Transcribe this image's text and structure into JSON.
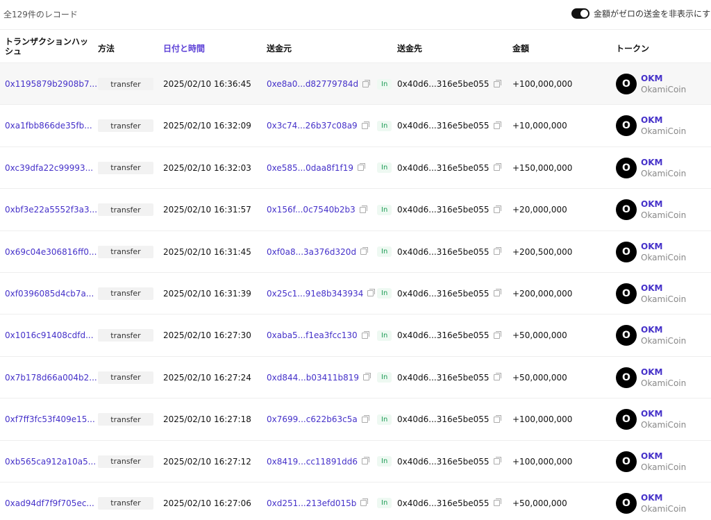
{
  "summary": {
    "record_count": "全129件のレコード",
    "hide_zero_label": "金額がゼロの送金を非表示にする"
  },
  "columns": {
    "hash": "トランザクションハッシュ",
    "method": "方法",
    "time": "日付と時間",
    "from": "送金元",
    "to": "送金先",
    "amount": "金額",
    "token": "トークン"
  },
  "rows": [
    {
      "hash": "0x1195879b2908b7...",
      "method": "transfer",
      "time": "2025/02/10 16:36:45",
      "from": "0xe8a0...d82779784d",
      "direction": "In",
      "to": "0x40d6...316e5be055",
      "amount": "+100,000,000",
      "token_symbol": "OKM",
      "token_name": "OkamiCoin",
      "token_logo": "O"
    },
    {
      "hash": "0xa1fbb866de35fb...",
      "method": "transfer",
      "time": "2025/02/10 16:32:09",
      "from": "0x3c74...26b37c08a9",
      "direction": "In",
      "to": "0x40d6...316e5be055",
      "amount": "+10,000,000",
      "token_symbol": "OKM",
      "token_name": "OkamiCoin",
      "token_logo": "O"
    },
    {
      "hash": "0xc39dfa22c99993...",
      "method": "transfer",
      "time": "2025/02/10 16:32:03",
      "from": "0xe585...0daa8f1f19",
      "direction": "In",
      "to": "0x40d6...316e5be055",
      "amount": "+150,000,000",
      "token_symbol": "OKM",
      "token_name": "OkamiCoin",
      "token_logo": "O"
    },
    {
      "hash": "0xbf3e22a5552f3a3...",
      "method": "transfer",
      "time": "2025/02/10 16:31:57",
      "from": "0x156f...0c7540b2b3",
      "direction": "In",
      "to": "0x40d6...316e5be055",
      "amount": "+20,000,000",
      "token_symbol": "OKM",
      "token_name": "OkamiCoin",
      "token_logo": "O"
    },
    {
      "hash": "0x69c04e306816ff0...",
      "method": "transfer",
      "time": "2025/02/10 16:31:45",
      "from": "0xf0a8...3a376d320d",
      "direction": "In",
      "to": "0x40d6...316e5be055",
      "amount": "+200,500,000",
      "token_symbol": "OKM",
      "token_name": "OkamiCoin",
      "token_logo": "O"
    },
    {
      "hash": "0xf0396085d4cb7a...",
      "method": "transfer",
      "time": "2025/02/10 16:31:39",
      "from": "0x25c1...91e8b343934",
      "direction": "In",
      "to": "0x40d6...316e5be055",
      "amount": "+200,000,000",
      "token_symbol": "OKM",
      "token_name": "OkamiCoin",
      "token_logo": "O"
    },
    {
      "hash": "0x1016c91408cdfd...",
      "method": "transfer",
      "time": "2025/02/10 16:27:30",
      "from": "0xaba5...f1ea3fcc130",
      "direction": "In",
      "to": "0x40d6...316e5be055",
      "amount": "+50,000,000",
      "token_symbol": "OKM",
      "token_name": "OkamiCoin",
      "token_logo": "O"
    },
    {
      "hash": "0x7b178d66a004b2...",
      "method": "transfer",
      "time": "2025/02/10 16:27:24",
      "from": "0xd844...b03411b819",
      "direction": "In",
      "to": "0x40d6...316e5be055",
      "amount": "+50,000,000",
      "token_symbol": "OKM",
      "token_name": "OkamiCoin",
      "token_logo": "O"
    },
    {
      "hash": "0xf7ff3fc53f409e15...",
      "method": "transfer",
      "time": "2025/02/10 16:27:18",
      "from": "0x7699...c622b63c5a",
      "direction": "In",
      "to": "0x40d6...316e5be055",
      "amount": "+100,000,000",
      "token_symbol": "OKM",
      "token_name": "OkamiCoin",
      "token_logo": "O"
    },
    {
      "hash": "0xb565ca912a10a5...",
      "method": "transfer",
      "time": "2025/02/10 16:27:12",
      "from": "0x8419...cc11891dd6",
      "direction": "In",
      "to": "0x40d6...316e5be055",
      "amount": "+100,000,000",
      "token_symbol": "OKM",
      "token_name": "OkamiCoin",
      "token_logo": "O"
    },
    {
      "hash": "0xad94df7f9f705ec...",
      "method": "transfer",
      "time": "2025/02/10 16:27:06",
      "from": "0xd251...213efd015b",
      "direction": "In",
      "to": "0x40d6...316e5be055",
      "amount": "+50,000,000",
      "token_symbol": "OKM",
      "token_name": "OkamiCoin",
      "token_logo": "O"
    }
  ]
}
